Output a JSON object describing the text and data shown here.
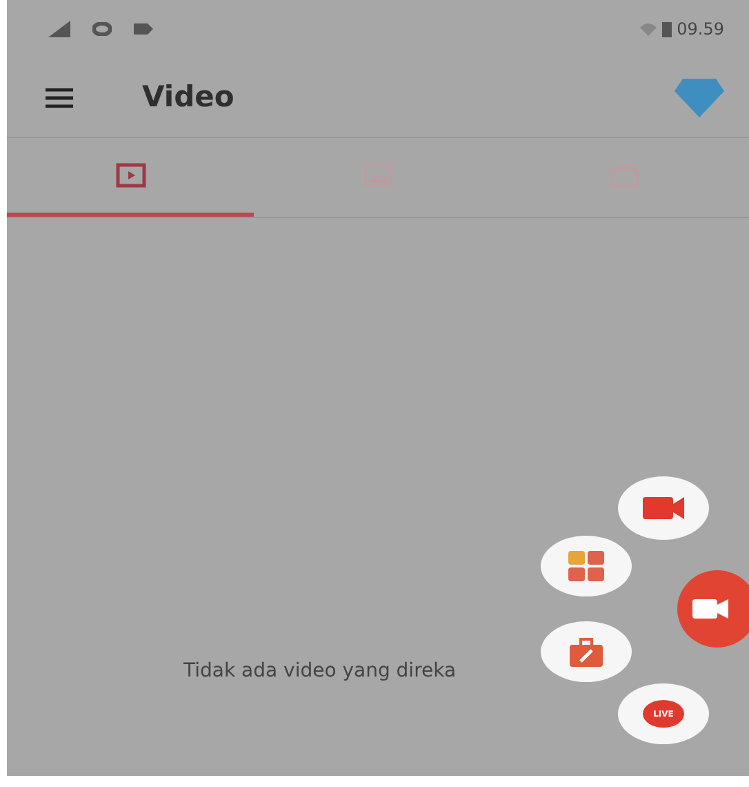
{
  "status_bar": {
    "time": "09.59"
  },
  "toolbar": {
    "title": "Video"
  },
  "tabs": [
    {
      "kind": "video",
      "selected": true
    },
    {
      "kind": "image",
      "selected": false
    },
    {
      "kind": "toolbox",
      "selected": false
    }
  ],
  "empty_message": "Tidak ada video yang direka",
  "fab_menu": {
    "items": [
      {
        "kind": "record"
      },
      {
        "kind": "tools"
      },
      {
        "kind": "toolbox"
      },
      {
        "kind": "live",
        "label": "LIVE"
      }
    ]
  }
}
